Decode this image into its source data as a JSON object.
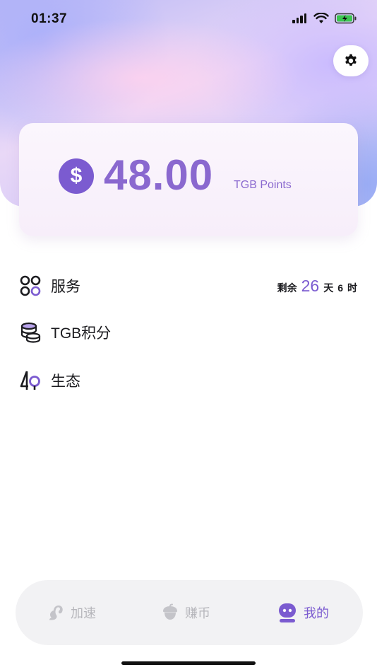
{
  "status_bar": {
    "time": "01:37",
    "icons": [
      "signal-icon",
      "wifi-icon",
      "battery-charging-icon"
    ]
  },
  "header": {
    "settings_icon": "gear-icon"
  },
  "points_card": {
    "currency_icon": "dollar-coin-icon",
    "value": "48.00",
    "unit": "TGB Points"
  },
  "menu": {
    "items": [
      {
        "icon": "services-grid-icon",
        "label": "服务"
      },
      {
        "icon": "coins-stack-icon",
        "label": "TGB积分"
      },
      {
        "icon": "ecosystem-icon",
        "label": "生态"
      }
    ],
    "remaining": {
      "prefix": "剩余",
      "days": "26",
      "days_unit": "天",
      "hours": "6",
      "hours_unit": "时"
    }
  },
  "tab_bar": {
    "tabs": [
      {
        "icon": "squirrel-icon",
        "label": "加速",
        "active": false
      },
      {
        "icon": "acorn-icon",
        "label": "赚币",
        "active": false
      },
      {
        "icon": "robot-face-icon",
        "label": "我的",
        "active": true
      }
    ]
  },
  "colors": {
    "accent": "#7b5bd0",
    "points_text": "#8a68cf",
    "tab_inactive": "#b6b6bb",
    "tab_bar_bg": "#f2f2f4"
  }
}
